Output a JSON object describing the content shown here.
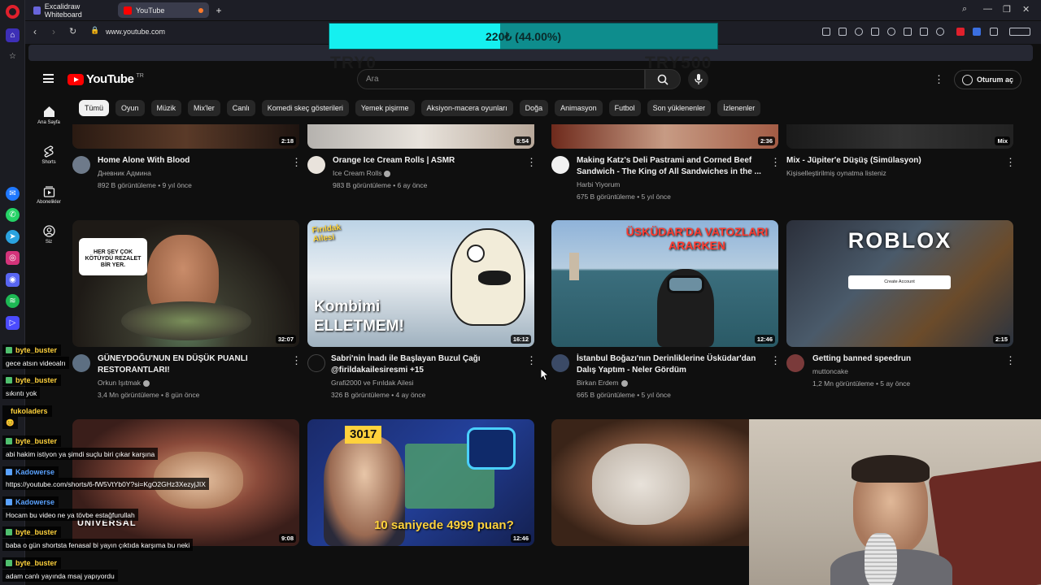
{
  "browser": {
    "tabs": [
      {
        "label": "Excalidraw Whiteboard",
        "active": false
      },
      {
        "label": "YouTube",
        "active": true
      }
    ],
    "url": "www.youtube.com"
  },
  "overlay": {
    "goal_text": "220₺ (44.00%)",
    "goal_progress": 0.44,
    "min_label": "TRY0",
    "max_label": "TRY500"
  },
  "youtube": {
    "logo_text": "YouTube",
    "country_code": "TR",
    "search_placeholder": "Ara",
    "signin_label": "Oturum aç",
    "sidebar": [
      {
        "label": "Ana Sayfa",
        "icon": "home-icon"
      },
      {
        "label": "Shorts",
        "icon": "shorts-icon"
      },
      {
        "label": "Abonelikler",
        "icon": "subscriptions-icon"
      },
      {
        "label": "Siz",
        "icon": "you-icon"
      }
    ],
    "chips": [
      "Tümü",
      "Oyun",
      "Müzik",
      "Mix'ler",
      "Canlı",
      "Komedi skeç gösterileri",
      "Yemek pişirme",
      "Aksiyon-macera oyunları",
      "Doğa",
      "Animasyon",
      "Futbol",
      "Son yüklenenler",
      "İzlenenler"
    ],
    "videos_row1": [
      {
        "title": "Home Alone With Blood",
        "channel": "Дневник Админа",
        "stats": "892 B görüntüleme • 9 yıl önce",
        "duration": "2:18"
      },
      {
        "title": "Orange Ice Cream Rolls | ASMR",
        "channel": "Ice Cream Rolls",
        "stats": "983 B görüntüleme • 6 ay önce",
        "duration": "8:54"
      },
      {
        "title": "Making Katz's Deli Pastrami and Corned Beef",
        "title2": "Sandwich - The King of All Sandwiches in the ...",
        "channel": "Harbi Yiyorum",
        "stats": "675 B görüntüleme • 5 yıl önce",
        "duration": "2:36"
      },
      {
        "title": "Mix - Jüpiter'e Düşüş (Simülasyon)",
        "channel": "Kişiselleştirilmiş oynatma listeniz",
        "stats": "",
        "duration": "Mix"
      }
    ],
    "videos_row2": [
      {
        "title": "GÜNEYDOĞU'NUN EN DÜŞÜK PUANLI",
        "title2": "RESTORANTLARI!",
        "channel": "Orkun Işıtmak",
        "stats": "3,4 Mn görüntüleme • 8 gün önce",
        "duration": "32:07",
        "thumb_text": "HER ŞEY ÇOK KÖTÜYDÜ REZALET BİR YER."
      },
      {
        "title": "Sabri'nin İnadı ile Başlayan Buzul Çağı",
        "title2": "@firildakailesiresmi +15",
        "channel": "Grafi2000 ve Fırıldak Ailesi",
        "stats": "326 B görüntüleme • 4 ay önce",
        "duration": "16:12",
        "thumb_text": "Kombimi ELLETMEM!",
        "thumb_logo": "Fırıldak Ailesi"
      },
      {
        "title": "İstanbul Boğazı'nın Derinliklerine Üsküdar'dan",
        "title2": "Dalış Yaptım - Neler Gördüm",
        "channel": "Birkan Erdem",
        "stats": "665 B görüntüleme • 5 yıl önce",
        "duration": "12:46",
        "thumb_text": "ÜSKÜDAR'DA VATOZLARI ARARKEN"
      },
      {
        "title": "Getting banned speedrun",
        "channel": "muttoncake",
        "stats": "1,2 Mn görüntüleme • 5 ay önce",
        "duration": "2:15",
        "thumb_text": "ROBLOX",
        "thumb_button": "Create Account"
      }
    ],
    "videos_row3": [
      {
        "duration": "9:08",
        "thumb_text": "UNIVERSAL"
      },
      {
        "duration": "12:46",
        "thumb_badge": "3017",
        "thumb_text": "10 saniyede 4999 puan?"
      },
      {
        "duration": ""
      }
    ]
  },
  "chat": [
    {
      "user": "byte_buster",
      "color": "#ffd23c",
      "msg": "gece atsın videoalrı"
    },
    {
      "user": "byte_buster",
      "color": "#ffd23c",
      "msg": "sıkıntı yok"
    },
    {
      "user": "fukoladers",
      "color": "#ffd23c",
      "msg": "😊"
    },
    {
      "user": "byte_buster",
      "color": "#ffd23c",
      "msg": "abi hakim istiyon ya şimdi suçlu biri çıkar karşına"
    },
    {
      "user": "Kadowerse",
      "color": "#5aa2ff",
      "msg": "https://youtube.com/shorts/6-fW5VtYb0Y?si=KgO2GHz3XezyjJIX"
    },
    {
      "user": "Kadowerse",
      "color": "#5aa2ff",
      "msg": "Hocam bu video ne ya tövbe estağfurullah"
    },
    {
      "user": "byte_buster",
      "color": "#ffd23c",
      "msg": "baba o gün shortsta fenasal bi yayın çıktıda karşıma bu neki"
    },
    {
      "user": "byte_buster",
      "color": "#ffd23c",
      "msg": "adam canlı yayında msaj yapıyordu"
    }
  ]
}
